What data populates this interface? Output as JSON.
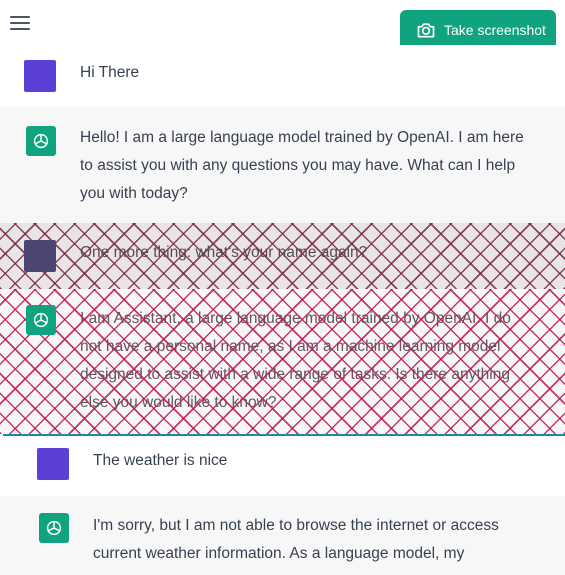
{
  "header": {
    "screenshot_button_label": "Take screenshot",
    "menu_icon": "hamburger-menu-icon",
    "camera_icon": "camera-icon"
  },
  "colors": {
    "accent": "#10a37f",
    "user_avatar": "#5b3fd6",
    "hatch": "#be1450",
    "selection_border": "#1e88a8"
  },
  "messages": [
    {
      "role": "user",
      "text": "Hi There"
    },
    {
      "role": "assistant",
      "text": "Hello! I am a large language model trained by OpenAI. I am here to assist you with any questions you may have. What can I help you with today?"
    },
    {
      "role": "user",
      "text": "One more thing: what's your name again?"
    },
    {
      "role": "assistant",
      "text": "I am Assistant, a large language model trained by OpenAI. I do not have a personal name, as I am a machine learning model designed to assist with a wide range of tasks. Is there anything else you would like to know?"
    },
    {
      "role": "user",
      "text": "The weather is nice"
    },
    {
      "role": "assistant",
      "text": "I'm sorry, but I am not able to browse the internet or access current weather information. As a language model, my"
    }
  ]
}
